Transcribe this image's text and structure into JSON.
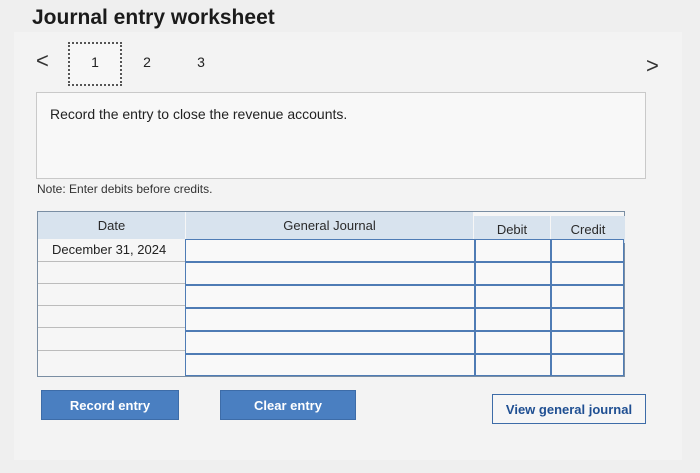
{
  "title": "Journal entry worksheet",
  "nav": {
    "prev": "<",
    "next": ">"
  },
  "steps": [
    "1",
    "2",
    "3"
  ],
  "active_step": "1",
  "prompt": "Record the entry to close the revenue accounts.",
  "note": "Note: Enter debits before credits.",
  "table": {
    "headers": {
      "date": "Date",
      "journal": "General Journal",
      "debit": "Debit",
      "credit": "Credit"
    },
    "first_date": "December 31, 2024"
  },
  "buttons": {
    "record": "Record entry",
    "clear": "Clear entry",
    "view": "View general journal"
  },
  "colors": {
    "accent": "#4a7fc1",
    "header_bg": "#d8e3ee",
    "input_border": "#4f7cb5"
  }
}
